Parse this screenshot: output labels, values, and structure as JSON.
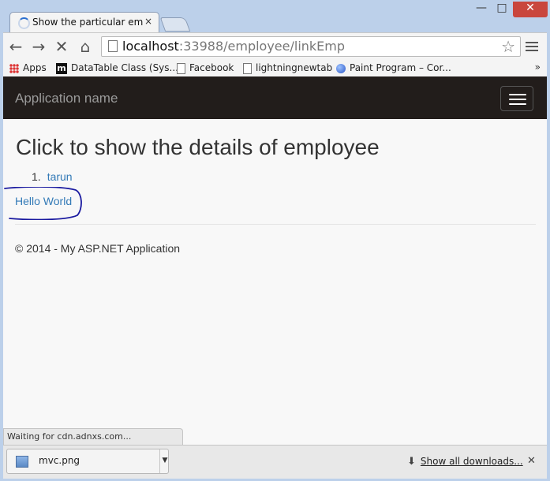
{
  "browser": {
    "tab_title": "Show the particular emplo",
    "tab_close": "×",
    "window_min": "▭",
    "window_max": "□",
    "window_close": "✕",
    "nav": {
      "back": "←",
      "forward": "→",
      "stop": "✕",
      "home": "⌂"
    },
    "address": {
      "host": "localhost",
      "path": ":33988/employee/linkEmp"
    },
    "star": "☆",
    "bookmarks": [
      {
        "label": "Apps",
        "icon": "apps-grid-icon"
      },
      {
        "label": "DataTable Class (Sys...",
        "icon": "m-logo-icon"
      },
      {
        "label": "Facebook",
        "icon": "page-icon"
      },
      {
        "label": "lightningnewtab",
        "icon": "page-icon"
      },
      {
        "label": "Paint Program – Cor...",
        "icon": "globe-icon"
      }
    ],
    "bookmarks_more": "»",
    "m_logo": "m",
    "status": "Waiting for cdn.adnxs.com...",
    "download": {
      "file": "mvc.png",
      "caret": "▼",
      "arrow": "⬇",
      "show_all": "Show all downloads...",
      "close": "✕"
    }
  },
  "page": {
    "brand": "Application name",
    "heading": "Click to show the details of employee",
    "employees": [
      {
        "num": "1.",
        "name": "tarun"
      }
    ],
    "hello_link": "Hello World",
    "footer": "© 2014 - My ASP.NET Application"
  },
  "colors": {
    "navbar": "#221d1b",
    "link": "#337ab7",
    "annotation_marker": "#1a1aa0"
  }
}
